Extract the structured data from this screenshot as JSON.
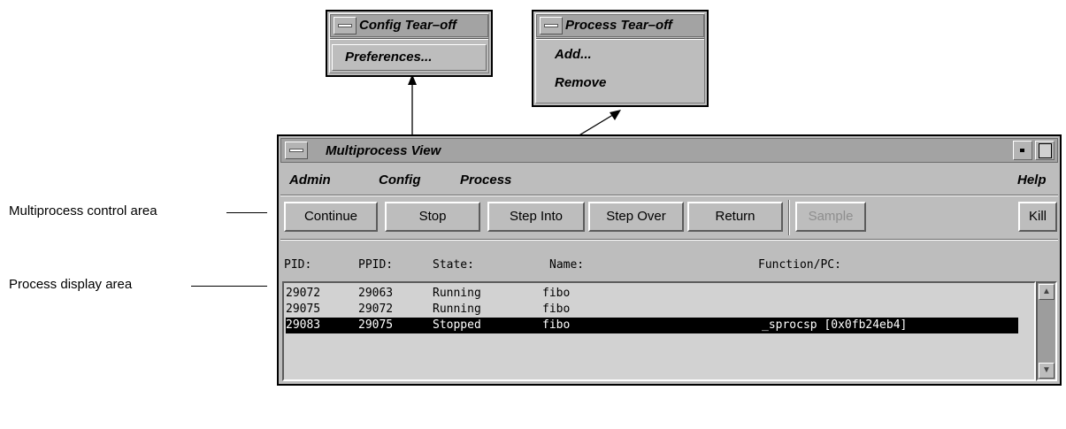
{
  "callouts": {
    "control_area": "Multiprocess control area",
    "display_area": "Process display area"
  },
  "config_tearoff": {
    "title": "Config Tear–off",
    "items": [
      {
        "label": "Preferences...",
        "mnemonic": "P"
      }
    ]
  },
  "process_tearoff": {
    "title": "Process Tear–off",
    "items": [
      {
        "label": "Add...",
        "mnemonic": "A"
      },
      {
        "label": "Remove",
        "mnemonic": "R"
      }
    ]
  },
  "window": {
    "title": "Multiprocess View",
    "menu": {
      "admin": "Admin",
      "config": "Config",
      "process": "Process",
      "help": "Help"
    },
    "buttons": {
      "continue": "Continue",
      "stop": "Stop",
      "step_into": "Step Into",
      "step_over": "Step Over",
      "return": "Return",
      "sample": "Sample",
      "kill": "Kill"
    },
    "columns": {
      "pid": "PID:",
      "ppid": "PPID:",
      "state": "State:",
      "name": "Name:",
      "function": "Function/PC:"
    },
    "rows": [
      {
        "pid": "29072",
        "ppid": "29063",
        "state": "Running",
        "name": "fibo",
        "function": ""
      },
      {
        "pid": "29075",
        "ppid": "29072",
        "state": "Running",
        "name": "fibo",
        "function": ""
      },
      {
        "pid": "29083",
        "ppid": "29075",
        "state": "Stopped",
        "name": "fibo",
        "function": "_sprocsp [0x0fb24eb4]"
      }
    ],
    "selected_row": 2
  }
}
